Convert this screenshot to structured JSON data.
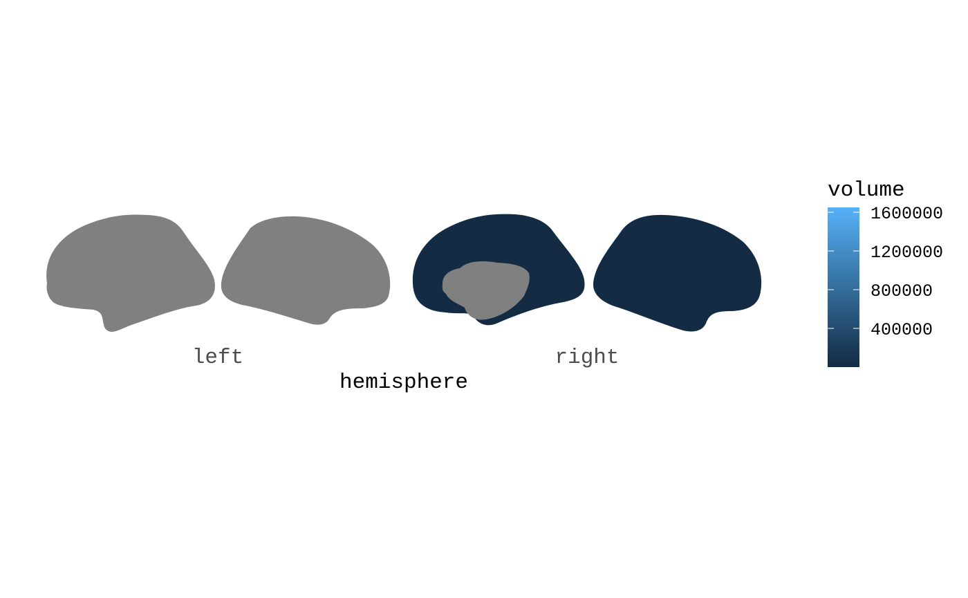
{
  "chart_data": {
    "type": "brain-map",
    "xlabel": "hemisphere",
    "categories": [
      "left",
      "right"
    ],
    "views": [
      "lateral",
      "medial"
    ],
    "regions": [
      {
        "hemisphere": "left",
        "view": "lateral",
        "value": null
      },
      {
        "hemisphere": "left",
        "view": "medial",
        "value": null
      },
      {
        "hemisphere": "right",
        "view": "lateral",
        "value": 0,
        "inner_region_value": null
      },
      {
        "hemisphere": "right",
        "view": "medial",
        "value": 0
      }
    ],
    "legend": {
      "title": "volume",
      "type": "colorbar",
      "placement": "right",
      "range": [
        0,
        1650000
      ],
      "breaks": [
        400000,
        800000,
        1200000,
        1600000
      ],
      "labels": [
        "400000",
        "800000",
        "1200000",
        "1600000"
      ],
      "low_color": "#132B43",
      "high_color": "#56B1F7"
    },
    "na_color": "#808080",
    "grid": false
  }
}
